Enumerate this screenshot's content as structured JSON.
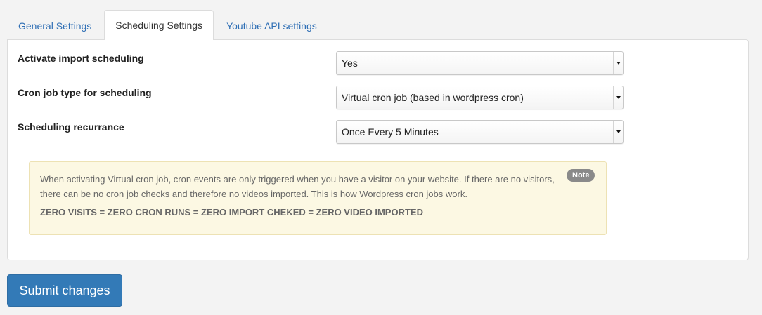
{
  "tabs": [
    {
      "label": "General Settings",
      "active": false
    },
    {
      "label": "Scheduling Settings",
      "active": true
    },
    {
      "label": "Youtube API settings",
      "active": false
    }
  ],
  "form": {
    "rows": [
      {
        "label": "Activate import scheduling",
        "value": "Yes"
      },
      {
        "label": "Cron job type for scheduling",
        "value": "Virtual cron job (based in wordpress cron)"
      },
      {
        "label": "Scheduling recurrance",
        "value": "Once Every 5 Minutes"
      }
    ]
  },
  "note": {
    "badge": "Note",
    "text": "When activating Virtual cron job, cron events are only triggered when you have a visitor on your website. If there are no visitors, there can be no cron job checks and therefore no videos imported. This is how Wordpress cron jobs work.",
    "warning": "ZERO VISITS = ZERO CRON RUNS = ZERO IMPORT CHEKED = ZERO VIDEO IMPORTED"
  },
  "submit": {
    "label": "Submit changes"
  },
  "colors": {
    "accent": "#337ab7",
    "link": "#2f6fb5",
    "note_bg": "#fcf8e3",
    "badge_bg": "#8a8a8a"
  }
}
